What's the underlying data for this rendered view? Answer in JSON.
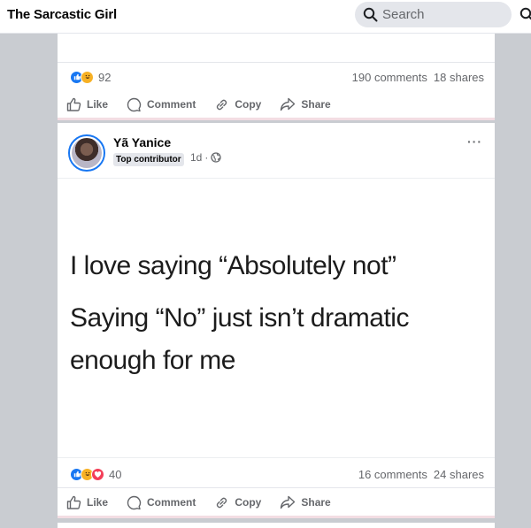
{
  "header": {
    "page_name": "The Sarcastic Girl",
    "search_placeholder": "Search"
  },
  "post_prev": {
    "reaction_count": "92",
    "comments": "190 comments",
    "shares": "18 shares",
    "reactions": [
      "like",
      "haha"
    ]
  },
  "post": {
    "author": "Yã Yanice",
    "badge": "Top contributor",
    "time": "1d",
    "separator": "·",
    "more": "···",
    "meme_lines": [
      "I love saying “Absolutely not”",
      "Saying “No” just isn’t dramatic",
      "enough for me"
    ],
    "reaction_count": "40",
    "comments": "16 comments",
    "shares": "24 shares",
    "reactions": [
      "like",
      "haha",
      "love"
    ]
  },
  "actions": {
    "like": "Like",
    "comment": "Comment",
    "copy": "Copy",
    "share": "Share"
  },
  "colors": {
    "accent": "#1877f2",
    "text_secondary": "#65676b",
    "background": "#c9ccd1"
  }
}
